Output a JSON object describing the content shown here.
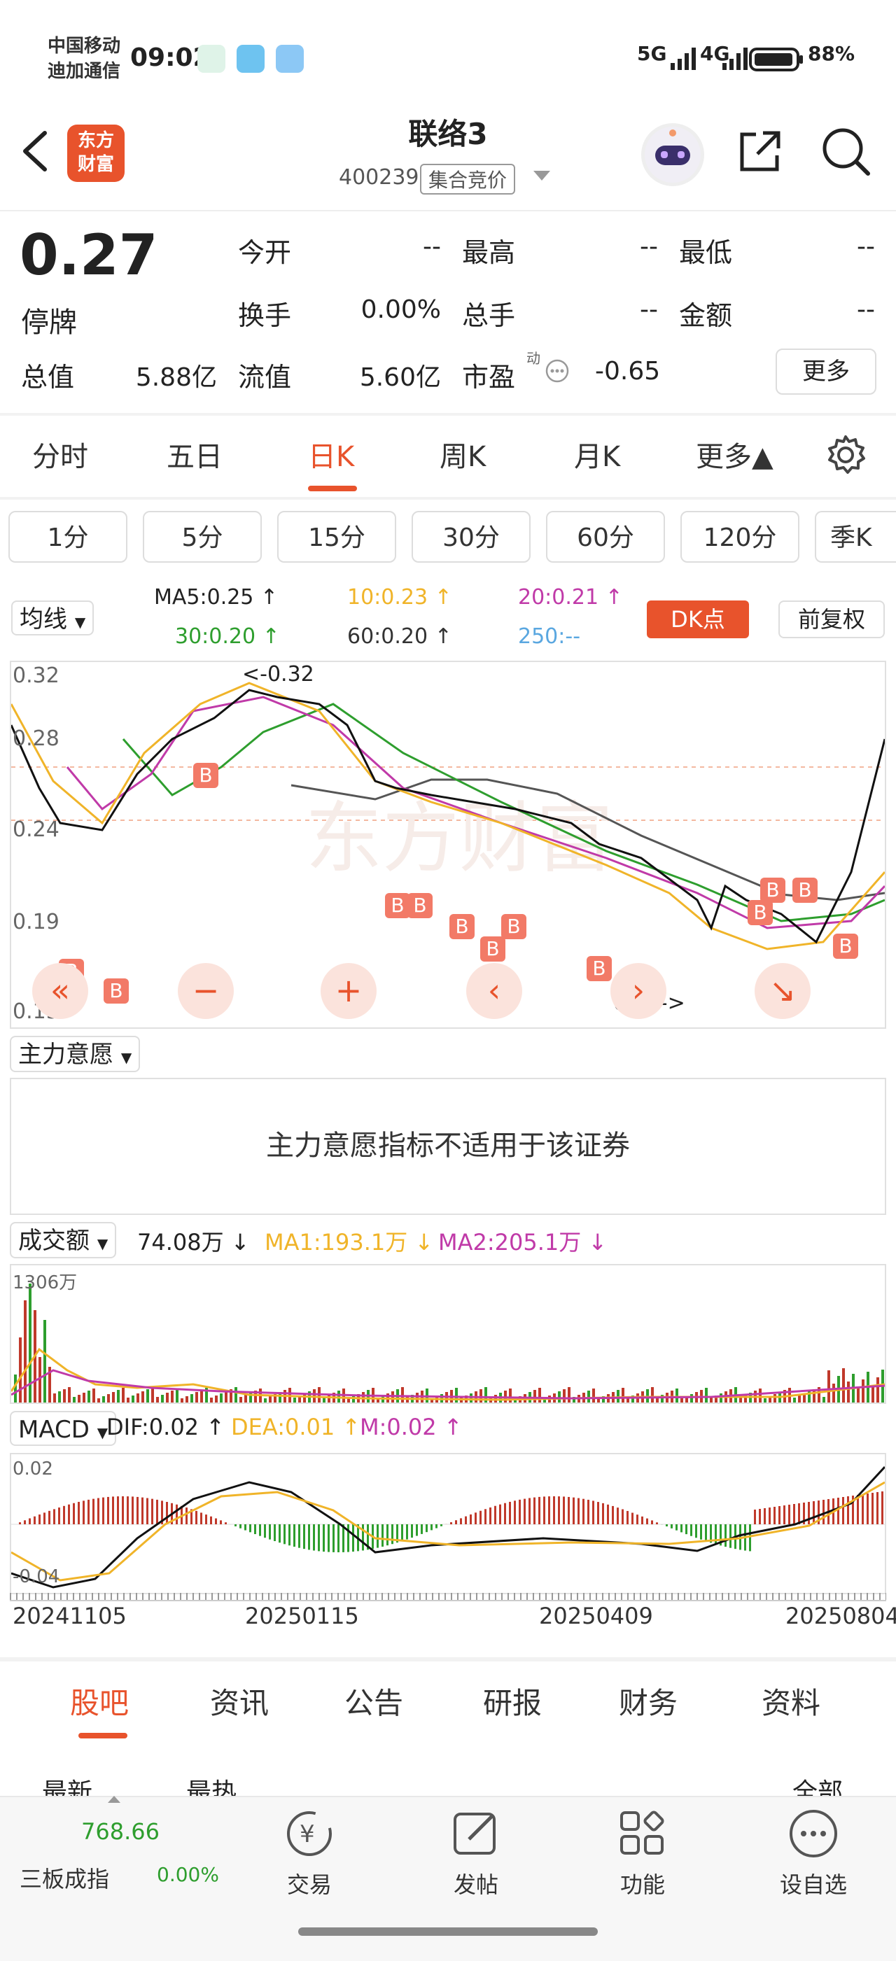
{
  "status_bar": {
    "carrier_line1": "中国移动",
    "carrier_line2": "迪加通信",
    "time": "09:02",
    "network1": "5G",
    "network2": "4G",
    "battery": "88%"
  },
  "header": {
    "logo_line1": "东方",
    "logo_line2": "财富",
    "stock_name": "联络3",
    "stock_code": "400239",
    "market_mode": "集合竞价"
  },
  "quote": {
    "price": "0.27",
    "status": "停牌",
    "fields": {
      "open_label": "今开",
      "open": "--",
      "high_label": "最高",
      "high": "--",
      "low_label": "最低",
      "low": "--",
      "turnover_label": "换手",
      "turnover": "0.00%",
      "volume_label": "总手",
      "volume": "--",
      "amount_label": "金额",
      "amount": "--",
      "total_mv_label": "总值",
      "total_mv": "5.88亿",
      "float_mv_label": "流值",
      "float_mv": "5.60亿",
      "pe_label": "市盈",
      "pe_sup": "动",
      "pe": "-0.65"
    },
    "more_label": "更多"
  },
  "period_tabs": [
    "分时",
    "五日",
    "日K",
    "周K",
    "月K",
    "更多▲"
  ],
  "active_period": "日K",
  "minute_buttons": [
    "1分",
    "5分",
    "15分",
    "30分",
    "60分",
    "120分",
    "季K"
  ],
  "ma_bar": {
    "selector": "均线",
    "ma5": "MA5:0.25 ↑",
    "ma10": "10:0.23 ↑",
    "ma20": "20:0.21 ↑",
    "ma30": "30:0.20 ↑",
    "ma60": "60:0.20 ↑",
    "ma250": "250:--",
    "dk_label": "DK点",
    "adjust_label": "前复权",
    "colors": {
      "ma5": "#222222",
      "ma10": "#f0b429",
      "ma20": "#c03aa8",
      "ma30": "#2e9e2e",
      "ma60": "#333333",
      "ma250": "#5aa7e0"
    }
  },
  "kline": {
    "y_labels": [
      "0.32",
      "0.28",
      "0.24",
      "0.19",
      "0.15"
    ],
    "high_marker": "<-0.32",
    "low_marker": "0.15->",
    "watermark": "东方财富"
  },
  "main_force": {
    "selector": "主力意愿",
    "note": "主力意愿指标不适用于该证券"
  },
  "volume": {
    "selector": "成交额",
    "value": "74.08万 ↓",
    "ma1": "MA1:193.1万 ↓",
    "ma2": "MA2:205.1万 ↓",
    "max_label": "1306万"
  },
  "macd": {
    "selector": "MACD",
    "dif": "DIF:0.02 ↑",
    "dea": "DEA:0.01 ↑",
    "m": "M:0.02 ↑",
    "y_top": "0.02",
    "y_bottom": "-0.04"
  },
  "dates": [
    "20241105",
    "20250115",
    "20250409",
    "20250804"
  ],
  "bottom_tabs": [
    "股吧",
    "资讯",
    "公告",
    "研报",
    "财务",
    "资料"
  ],
  "feed_partial": {
    "left": "最新",
    "mid": "最热",
    "right": "全部"
  },
  "bottom_nav": {
    "index_value": "768.66",
    "index_name": "三板成指",
    "index_change": "0.00%",
    "items": [
      "交易",
      "发帖",
      "功能",
      "设自选"
    ]
  }
}
